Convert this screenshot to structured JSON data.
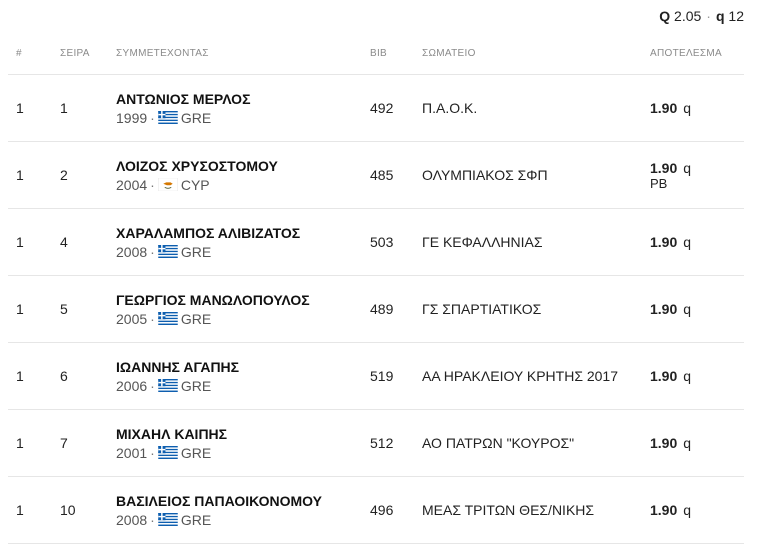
{
  "qualification": {
    "mark_letter": "Q",
    "mark_value": "2.05",
    "separator": "·",
    "place_letter": "q",
    "place_value": "12"
  },
  "columns": {
    "heat": "#",
    "lane": "ΣΕΙΡΑ",
    "athlete": "ΣΥΜΜΕΤΕΧΟΝΤΑΣ",
    "bib": "BIB",
    "club": "ΣΩΜΑΤΕΙΟ",
    "result": "ΑΠΟΤΕΛΕΣΜΑ"
  },
  "rows": [
    {
      "heat": "1",
      "lane": "1",
      "name": "ΑΝΤΩΝΙΟΣ ΜΕΡΛΟΣ",
      "year": "1999",
      "sep": "·",
      "country": "GRE",
      "flag": "greece-flag-icon",
      "bib": "492",
      "club": "Π.Α.Ο.Κ.",
      "mark": "1.90",
      "qual": "q",
      "note": ""
    },
    {
      "heat": "1",
      "lane": "2",
      "name": "ΛΟΙΖΟΣ ΧΡΥΣΟΣΤΟΜΟΥ",
      "year": "2004",
      "sep": "·",
      "country": "CYP",
      "flag": "cyprus-flag-icon",
      "bib": "485",
      "club": "ΟΛΥΜΠΙΑΚΟΣ ΣΦΠ",
      "mark": "1.90",
      "qual": "q",
      "note": "PB"
    },
    {
      "heat": "1",
      "lane": "4",
      "name": "ΧΑΡΑΛΑΜΠΟΣ ΑΛΙΒΙΖΑΤΟΣ",
      "year": "2008",
      "sep": "·",
      "country": "GRE",
      "flag": "greece-flag-icon",
      "bib": "503",
      "club": "ΓΕ ΚΕΦΑΛΛΗΝΙΑΣ",
      "mark": "1.90",
      "qual": "q",
      "note": ""
    },
    {
      "heat": "1",
      "lane": "5",
      "name": "ΓΕΩΡΓΙΟΣ ΜΑΝΩΛΟΠΟΥΛΟΣ",
      "year": "2005",
      "sep": "·",
      "country": "GRE",
      "flag": "greece-flag-icon",
      "bib": "489",
      "club": "ΓΣ ΣΠΑΡΤΙΑΤΙΚΟΣ",
      "mark": "1.90",
      "qual": "q",
      "note": ""
    },
    {
      "heat": "1",
      "lane": "6",
      "name": "ΙΩΑΝΝΗΣ ΑΓΑΠΗΣ",
      "year": "2006",
      "sep": "·",
      "country": "GRE",
      "flag": "greece-flag-icon",
      "bib": "519",
      "club": "ΑΑ ΗΡΑΚΛΕΙΟΥ ΚΡΗΤΗΣ 2017",
      "mark": "1.90",
      "qual": "q",
      "note": ""
    },
    {
      "heat": "1",
      "lane": "7",
      "name": "ΜΙΧΑΗΛ ΚΑΙΠΗΣ",
      "year": "2001",
      "sep": "·",
      "country": "GRE",
      "flag": "greece-flag-icon",
      "bib": "512",
      "club": "ΑΟ ΠΑΤΡΩΝ \"ΚΟΥΡΟΣ\"",
      "mark": "1.90",
      "qual": "q",
      "note": ""
    },
    {
      "heat": "1",
      "lane": "10",
      "name": "ΒΑΣΙΛΕΙΟΣ ΠΑΠΑΟΙΚΟΝΟΜΟΥ",
      "year": "2008",
      "sep": "·",
      "country": "GRE",
      "flag": "greece-flag-icon",
      "bib": "496",
      "club": "ΜΕΑΣ ΤΡΙΤΩΝ ΘΕΣ/ΝΙΚΗΣ",
      "mark": "1.90",
      "qual": "q",
      "note": ""
    }
  ],
  "colors": {
    "greece_blue": "#0d5eaf",
    "cyprus_copper": "#d57800",
    "cyprus_olive": "#4e5b31",
    "divider": "#e6e6e6"
  }
}
